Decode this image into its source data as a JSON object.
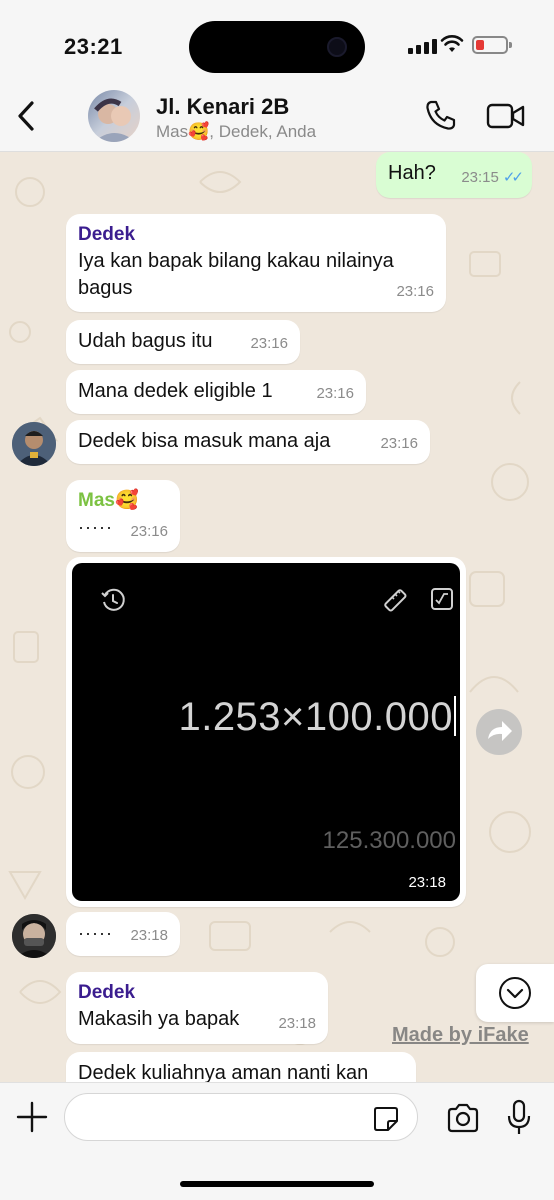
{
  "status_bar": {
    "time": "23:21"
  },
  "header": {
    "title": "Jl. Kenari 2B",
    "subtitle": "Mas🥰, Dedek, Anda"
  },
  "messages": [
    {
      "direction": "out",
      "text": "Hah?",
      "time": "23:15",
      "read": true
    },
    {
      "direction": "in",
      "sender": "Dedek",
      "sender_color": "#3b1d8f",
      "text": "Iya kan bapak bilang kakau nilainya bagus",
      "time": "23:16"
    },
    {
      "direction": "in",
      "text": "Udah bagus itu",
      "time": "23:16"
    },
    {
      "direction": "in",
      "text": "Mana dedek eligible 1",
      "time": "23:16"
    },
    {
      "direction": "in",
      "text": "Dedek bisa masuk mana aja",
      "time": "23:16"
    },
    {
      "direction": "in",
      "sender": "Mas🥰",
      "sender_color": "#7cc242",
      "text": "·····",
      "time": "23:16"
    },
    {
      "direction": "in",
      "type": "image",
      "calc_expression": "1.253×100.000",
      "calc_result": "125.300.000",
      "time": "23:18"
    },
    {
      "direction": "in",
      "text": "·····",
      "time": "23:18"
    },
    {
      "direction": "in",
      "sender": "Dedek",
      "sender_color": "#3b1d8f",
      "text": "Makasih ya bapak",
      "time": "23:18"
    },
    {
      "direction": "in",
      "text": "Dedek kuliahnya aman nanti kan",
      "time": ""
    }
  ],
  "watermark": "Made by iFake",
  "composer": {
    "placeholder": ""
  },
  "icons": {
    "back": "chevron-left-icon",
    "call": "phone-icon",
    "video": "video-camera-icon",
    "plus": "plus-icon",
    "sticker": "sticker-icon",
    "camera": "camera-icon",
    "mic": "microphone-icon",
    "forward": "forward-arrow-icon",
    "scroll_down": "chevron-down-icon"
  },
  "colors": {
    "outgoing_bubble": "#d9fdd3",
    "incoming_bubble": "#ffffff",
    "read_ticks": "#4fa0e9",
    "chat_bg": "#efe7dc"
  }
}
